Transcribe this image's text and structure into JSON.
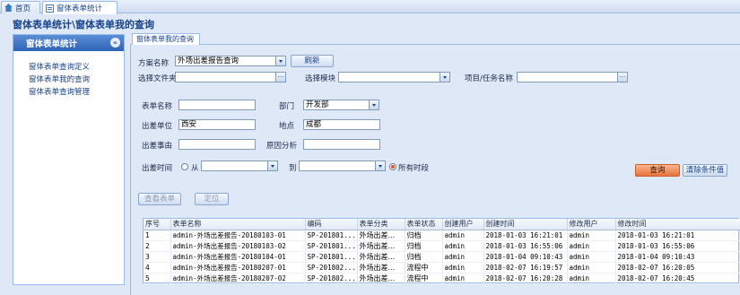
{
  "tabs": [
    {
      "label": "首页",
      "icon": "home-icon"
    },
    {
      "label": "窗体表单统计",
      "icon": "form-icon"
    }
  ],
  "page_title": "窗体表单统计\\窗体表单我的查询",
  "nav": {
    "header": "窗体表单统计",
    "collapse_glyph": "«",
    "items": [
      "窗体表单查询定义",
      "窗体表单我的查询",
      "窗体表单查询管理"
    ]
  },
  "main_tab": "窗体表单我的查询",
  "form": {
    "scheme_label": "方案名称",
    "scheme_value": "外场出差报告查询",
    "refresh_button": "刷新",
    "folder_label": "选择文件夹",
    "folder_value": "",
    "module_label": "选择模块",
    "module_value": "",
    "project_label": "项目/任务名称",
    "project_value": "",
    "formname_label": "表单名称",
    "formname_value": "",
    "dept_label": "部门",
    "dept_value": "开发部",
    "unit_label": "出差单位",
    "unit_value": "西安",
    "place_label": "地点",
    "place_value": "成都",
    "reason_label": "出差事由",
    "reason_value": "",
    "cause_label": "原因分析",
    "cause_value": "",
    "time_label": "出差时间",
    "from_label": "从",
    "to_label": "到",
    "alltime_label": "所有时段",
    "from_value": "",
    "to_value": "",
    "query_button": "查询",
    "clear_button": "清除条件值",
    "view_button": "查看表单",
    "locate_button": "定位"
  },
  "grid": {
    "columns": [
      "序号",
      "表单名称",
      "编码",
      "表单分类",
      "表单状态",
      "创建用户",
      "创建时间",
      "修改用户",
      "修改时间"
    ],
    "rows": [
      [
        "1",
        "admin-外场出差报告-20180103-01",
        "SP-201801...",
        "外场出差...",
        "归档",
        "admin",
        "2018-01-03 16:21:01",
        "admin",
        "2018-01-03 16:21:01"
      ],
      [
        "2",
        "admin-外场出差报告-20180103-02",
        "SP-201801...",
        "外场出差...",
        "归档",
        "admin",
        "2018-01-03 16:55:06",
        "admin",
        "2018-01-03 16:55:06"
      ],
      [
        "3",
        "admin-外场出差报告-20180104-01",
        "SP-201801...",
        "外场出差...",
        "归档",
        "admin",
        "2018-01-04 09:10:43",
        "admin",
        "2018-01-04 09:10:43"
      ],
      [
        "4",
        "admin-外场出差报告-20180207-01",
        "SP-201802...",
        "外场出差...",
        "流程中",
        "admin",
        "2018-02-07 16:19:57",
        "admin",
        "2018-02-07 16:20:05"
      ],
      [
        "5",
        "admin-外场出差报告-20180207-02",
        "SP-201802...",
        "外场出差...",
        "流程中",
        "admin",
        "2018-02-07 16:20:28",
        "admin",
        "2018-02-07 16:20:45"
      ]
    ]
  }
}
